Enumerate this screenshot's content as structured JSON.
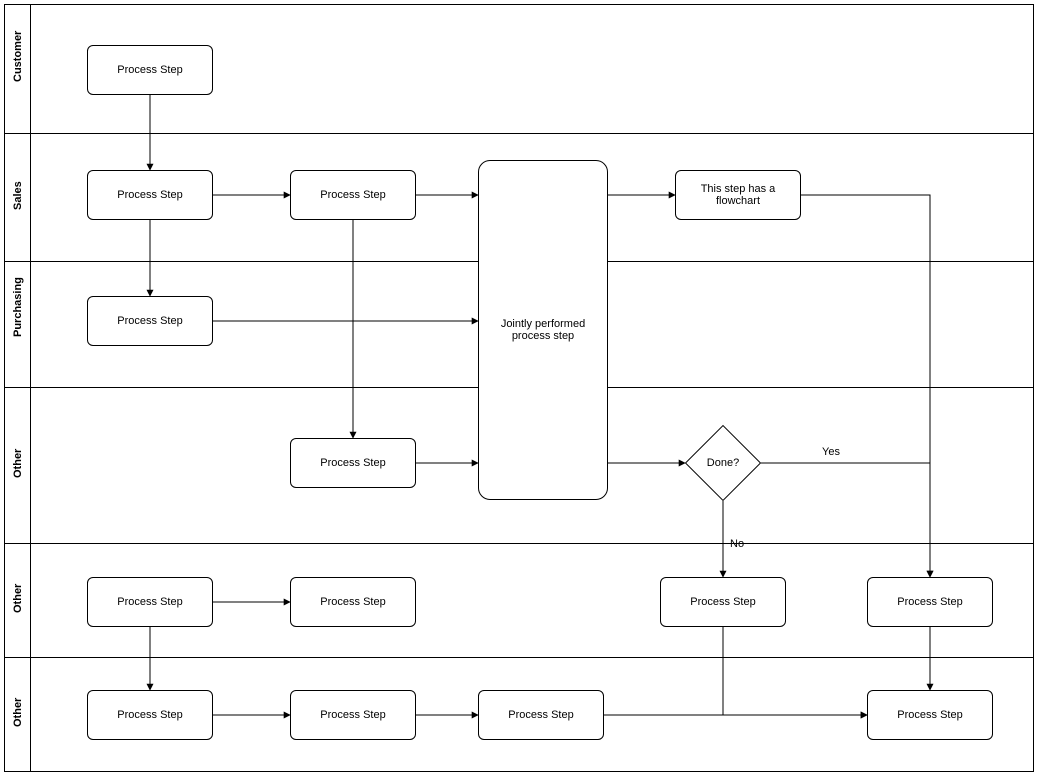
{
  "lanes": {
    "l1": "Customer",
    "l2": "Sales",
    "l3": "Purchasing",
    "l4": "Other",
    "l5": "Other",
    "l6": "Other"
  },
  "nodes": {
    "n1": "Process Step",
    "n2": "Process Step",
    "n3": "Process Step",
    "n4": "This step has a flowchart",
    "n5": "Process Step",
    "n6": "Jointly performed process step",
    "n7": "Process Step",
    "d1": "Done?",
    "n8": "Process Step",
    "n9": "Process Step",
    "n10": "Process Step",
    "n11": "Process Step",
    "n12": "Process Step",
    "n13": "Process Step",
    "n14": "Process Step",
    "n15": "Process Step"
  },
  "edge_labels": {
    "yes": "Yes",
    "no": "No"
  }
}
